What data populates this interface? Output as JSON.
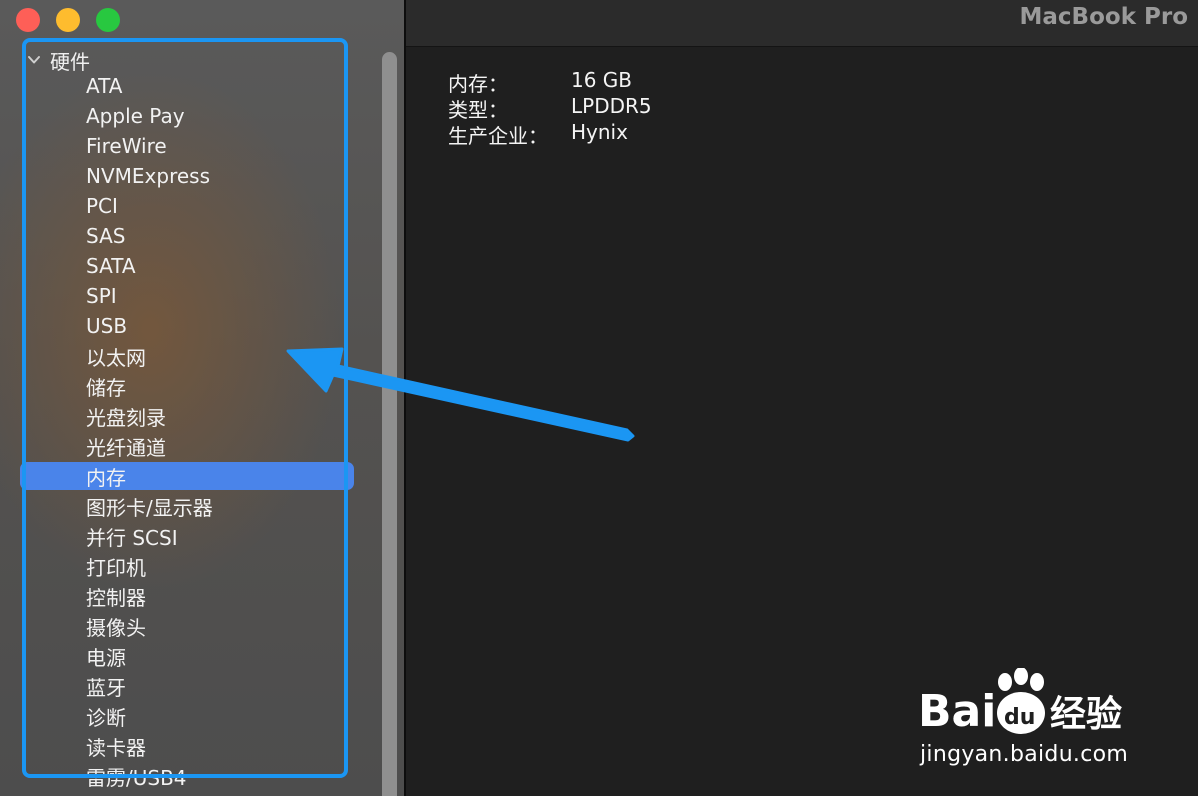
{
  "window": {
    "title": "MacBook Pro"
  },
  "sidebar": {
    "root_label": "硬件",
    "items": [
      {
        "label": "ATA"
      },
      {
        "label": "Apple Pay"
      },
      {
        "label": "FireWire"
      },
      {
        "label": "NVMExpress"
      },
      {
        "label": "PCI"
      },
      {
        "label": "SAS"
      },
      {
        "label": "SATA"
      },
      {
        "label": "SPI"
      },
      {
        "label": "USB"
      },
      {
        "label": "以太网"
      },
      {
        "label": "储存"
      },
      {
        "label": "光盘刻录"
      },
      {
        "label": "光纤通道"
      },
      {
        "label": "内存",
        "selected": true
      },
      {
        "label": "图形卡/显示器"
      },
      {
        "label": "并行 SCSI"
      },
      {
        "label": "打印机"
      },
      {
        "label": "控制器"
      },
      {
        "label": "摄像头"
      },
      {
        "label": "电源"
      },
      {
        "label": "蓝牙"
      },
      {
        "label": "诊断"
      },
      {
        "label": "读卡器"
      },
      {
        "label": "雷雳/USB4"
      }
    ]
  },
  "details": {
    "rows": [
      {
        "label": "内存：",
        "value": "16 GB"
      },
      {
        "label": "类型：",
        "value": "LPDDR5"
      },
      {
        "label": "生产企业：",
        "value": "Hynix"
      }
    ]
  },
  "colors": {
    "selection": "#4a84ea",
    "annotation": "#1b96f3",
    "close": "#fe5f57",
    "minimize": "#febc2e",
    "maximize": "#28c840"
  },
  "watermark": {
    "brand": "Bai du 经验",
    "url": "jingyan.baidu.com"
  }
}
